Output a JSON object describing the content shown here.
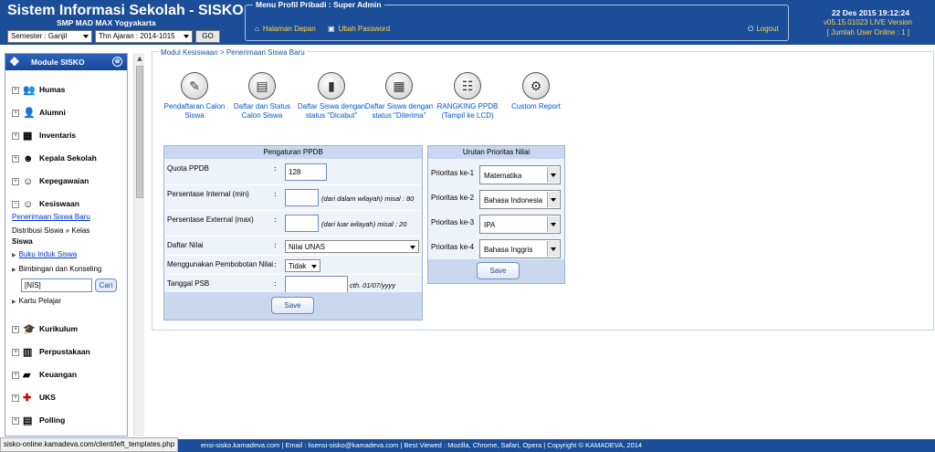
{
  "header": {
    "app_title": "Sistem Informasi Sekolah - SISKO",
    "school_name": "SMP MAD MAX Yogyakarta",
    "semester_select": "Semester : Ganjil",
    "year_select": "Thn Ajaran : 2014-1015",
    "go_label": "GO",
    "menu_legend": "Menu Profil Pribadi : Super Admin",
    "home_link": "Halaman Depan",
    "password_link": "Ubah Password",
    "logout_label": "Logout",
    "datetime": "22 Des 2015 19:12:24",
    "version": "v05.15.01023 LIVE Version",
    "online": "[ Jumlah User Online : 1 ]"
  },
  "sidebar": {
    "title": "Module SISKO",
    "modules": [
      {
        "label": "Humas",
        "icon": "people-icon"
      },
      {
        "label": "Alumni",
        "icon": "graduates-icon"
      },
      {
        "label": "Inventaris",
        "icon": "boxes-icon"
      },
      {
        "label": "Kepala Sekolah",
        "icon": "headmaster-icon"
      },
      {
        "label": "Kepegawaian",
        "icon": "staff-icon"
      },
      {
        "label": "Kesiswaan",
        "icon": "student-icon"
      },
      {
        "label": "Kurikulum",
        "icon": "mortarboard-icon"
      },
      {
        "label": "Perpustakaan",
        "icon": "books-icon"
      },
      {
        "label": "Keuangan",
        "icon": "money-icon"
      },
      {
        "label": "UKS",
        "icon": "medical-cross-icon"
      },
      {
        "label": "Polling",
        "icon": "list-icon"
      }
    ],
    "kesiswaan_sub": {
      "penerimaan": "Penerimaan Siswa Baru",
      "distribusi": "Distribusi Siswa » Kelas",
      "siswa": "Siswa",
      "buku_induk": "Buku Induk Siswa",
      "bimbingan": "Bimbingan dan Konseling",
      "nis_value": "[NIS]",
      "cari": "Cari",
      "kartu": "Kartu Pelajar"
    }
  },
  "content": {
    "breadcrumb": "Modul Kesiswaan > Penerimaan Siswa Baru",
    "quick_links": [
      {
        "label1": "Pendaftaran Calon",
        "label2": "Siswa",
        "icon": "form-icon"
      },
      {
        "label1": "Daftar dan Status",
        "label2": "Calon Siswa",
        "icon": "folder-icon"
      },
      {
        "label1": "Daftar Siswa dengan",
        "label2": "status \"Dicabut\"",
        "icon": "book-icon"
      },
      {
        "label1": "Daftar Siswa dengan",
        "label2": "status \"Diterima\"",
        "icon": "cabinet-icon"
      },
      {
        "label1": "RANGKING PPDB",
        "label2": "(Tampil ke LCD)",
        "icon": "ranking-icon"
      },
      {
        "label1": "Custom Report",
        "label2": "",
        "icon": "report-icon"
      }
    ],
    "ppdb": {
      "title": "Pengaturan PPDB",
      "quota_label": "Quota PPDB",
      "quota_value": "128",
      "internal_label": "Persentase Internal (min)",
      "internal_note": "(dari dalam wilayah) misal : 80",
      "external_label": "Persentase External (max)",
      "external_note": "(dari luar wilayah) misal : 20",
      "daftar_label": "Daftar Nilai",
      "daftar_value": "Nilai UNAS",
      "bobot_label": "Menggunakan Pembobotan Nilai",
      "bobot_value": "Tidak",
      "tanggal_label": "Tanggal PSB",
      "tanggal_note": "cth. 01/07/yyyy",
      "colon": ":",
      "save": "Save"
    },
    "priority": {
      "title": "Urutan Prioritas Nilai",
      "rows": [
        {
          "label": "Prioritas ke-1",
          "value": "Matematika"
        },
        {
          "label": "Prioritas ke-2",
          "value": "Bahasa Indonesia"
        },
        {
          "label": "Prioritas ke-3",
          "value": "IPA"
        },
        {
          "label": "Prioritas ke-4",
          "value": "Bahasa Inggris"
        }
      ],
      "save": "Save"
    }
  },
  "footer": {
    "text": "ensi-sisko.kamadeva.com   |   Email : lisensi-sisko@kamadeva.com   |   Best Viewed : Mozilla, Chrome, Safari, Opera   |   Copyright © KAMADEVA, 2014",
    "url_tooltip": "sisko-online.kamadeva.com/client/left_templates.php"
  }
}
